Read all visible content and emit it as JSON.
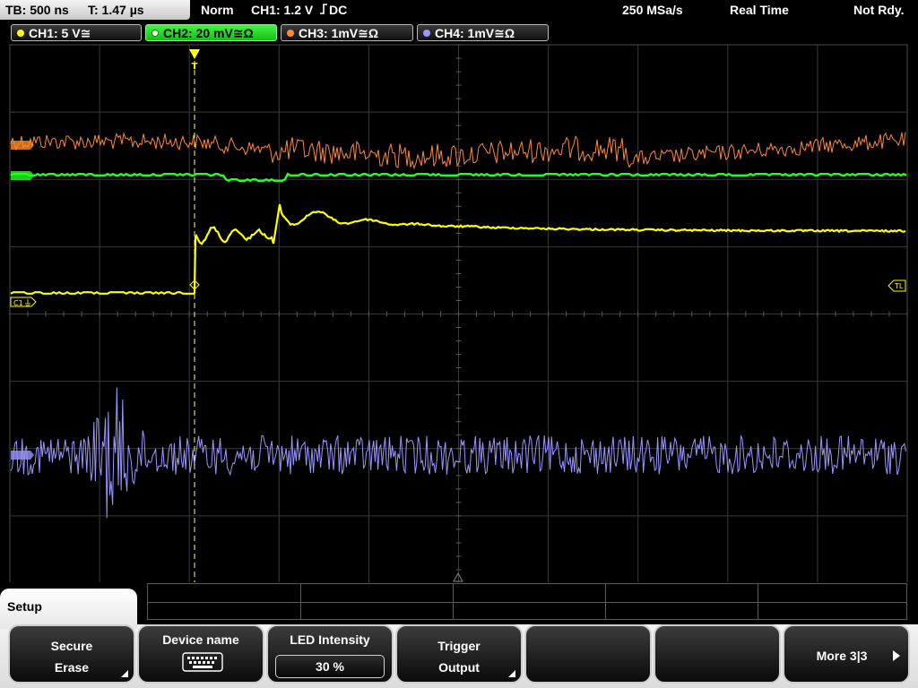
{
  "header": {
    "timebase_label": "TB: 500 ns",
    "trigger_time_label": "T: 1.47 µs",
    "mode": "Norm",
    "trigger_source": "CH1: 1.2 V",
    "trigger_coupling": "DC",
    "sample_rate": "250 MSa/s",
    "acquisition": "Real Time",
    "status": "Not Rdy."
  },
  "channels": [
    {
      "label": "CH1: 5 V",
      "coupling": "≅",
      "color": "#ffff00",
      "active": false
    },
    {
      "label": "CH2: 20 mV",
      "coupling": "≅Ω",
      "color": "#22ff22",
      "active": true
    },
    {
      "label": "CH3: 1mV",
      "coupling": "≅Ω",
      "color": "#ff8a2b",
      "active": false
    },
    {
      "label": "CH4: 1mV",
      "coupling": "≅Ω",
      "color": "#9a96ff",
      "active": false
    }
  ],
  "screen": {
    "markers": {
      "ch1": "C1",
      "trigger_level": "TL",
      "trigger_position": "T"
    },
    "waveform_colors": {
      "ch1": "#ffff00",
      "ch2": "#22ff22",
      "ch3": "#ff8a2b",
      "ch4": "#9a96ff",
      "trigger_marker": "#ffff00"
    }
  },
  "menu": {
    "title": "Setup",
    "softkeys": [
      {
        "line1": "Secure",
        "line2": "Erase",
        "has_submenu": true
      },
      {
        "line1": "Device name",
        "icon": "keyboard-icon"
      },
      {
        "line1": "LED Intensity",
        "value": "30 %"
      },
      {
        "line1": "Trigger",
        "line2": "Output",
        "has_submenu": true
      },
      {
        "line1": ""
      },
      {
        "line1": ""
      },
      {
        "line1": "More 3|3",
        "icon": "arrow-right-icon"
      }
    ]
  }
}
